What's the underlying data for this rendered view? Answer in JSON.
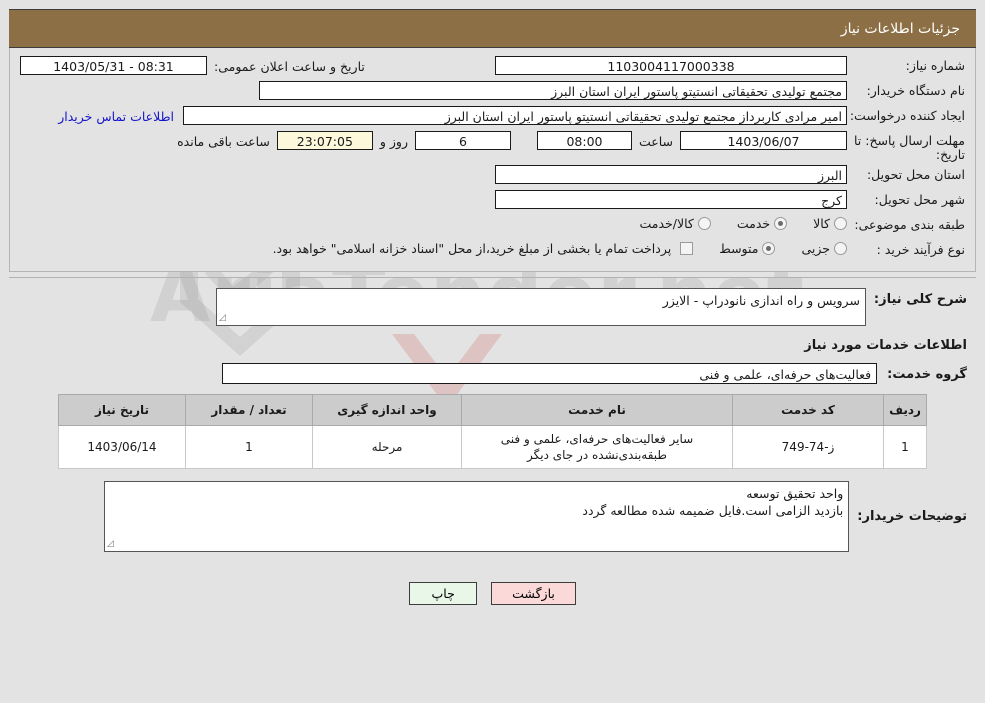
{
  "header": {
    "title": "جزئیات اطلاعات نیاز"
  },
  "colors": {
    "header_bg": "#8c6f45",
    "page_bg": "#e3e3e3",
    "link": "#1414cc",
    "countdown_bg": "#fbf8dc",
    "print_btn_bg": "#e8f7e8",
    "back_btn_bg": "#fbd9d9",
    "table_header_bg": "#cccccc"
  },
  "info": {
    "need_number_label": "شماره نیاز:",
    "need_number_value": "1103004117000338",
    "public_announce_label": "تاریخ و ساعت اعلان عمومی:",
    "public_announce_value": "1403/05/31 - 08:31",
    "buyer_org_label": "نام دستگاه خریدار:",
    "buyer_org_value": "مجتمع تولیدی تحقیقاتی انستیتو پاستور ایران استان البرز",
    "creator_label": "ایجاد کننده درخواست:",
    "creator_value": "امیر مرادی کاربرداز مجتمع تولیدی تحقیقاتی انستیتو پاستور ایران استان البرز",
    "contact_link": "اطلاعات تماس خریدار",
    "deadline_label": "مهلت ارسال پاسخ: تا تاریخ:",
    "deadline_date": "1403/06/07",
    "hour_label": "ساعت",
    "deadline_time": "08:00",
    "days_remaining": "6",
    "days_and_label": "روز و",
    "countdown": "23:07:05",
    "hours_remaining_label": "ساعت باقی مانده",
    "province_label": "استان محل تحویل:",
    "province_value": "البرز",
    "city_label": "شهر محل تحویل:",
    "city_value": "کرج",
    "category_label": "طبقه بندی موضوعی:",
    "category_options": [
      {
        "label": "کالا",
        "selected": false
      },
      {
        "label": "خدمت",
        "selected": true
      },
      {
        "label": "کالا/خدمت",
        "selected": false
      }
    ],
    "process_label": "نوع فرآیند خرید :",
    "process_options": [
      {
        "label": "جزیی",
        "selected": false
      },
      {
        "label": "متوسط",
        "selected": true
      }
    ],
    "treasury_checkbox_text": "پرداخت تمام یا بخشی از مبلغ خرید،از محل \"اسناد خزانه اسلامی\" خواهد بود.",
    "treasury_checked": false
  },
  "detail": {
    "need_desc_label": "شرح کلی نیاز:",
    "need_desc_value": "سرویس و راه اندازی نانودراپ - الایزر",
    "section_title": "اطلاعات خدمات مورد نیاز",
    "service_group_label": "گروه خدمت:",
    "service_group_value": "فعالیت‌های حرفه‌ای، علمی و فنی",
    "buyer_notes_label": "توضیحات خریدار:",
    "buyer_notes_value": "واحد تحقیق توسعه\nبازدید الزامی است.فایل ضمیمه شده مطالعه گردد"
  },
  "table": {
    "headers": [
      "ردیف",
      "کد خدمت",
      "نام خدمت",
      "واحد اندازه گیری",
      "تعداد / مقدار",
      "تاریخ نیاز"
    ],
    "rows": [
      {
        "row": "1",
        "code": "ز-74-749",
        "name": "سایر فعالیت‌های حرفه‌ای، علمی و فنی طبقه‌بندی‌نشده در جای دیگر",
        "unit": "مرحله",
        "qty": "1",
        "date": "1403/06/14"
      }
    ]
  },
  "footer": {
    "print_label": "چاپ",
    "back_label": "بازگشت"
  },
  "watermark": {
    "text": "AriaTender.net"
  }
}
